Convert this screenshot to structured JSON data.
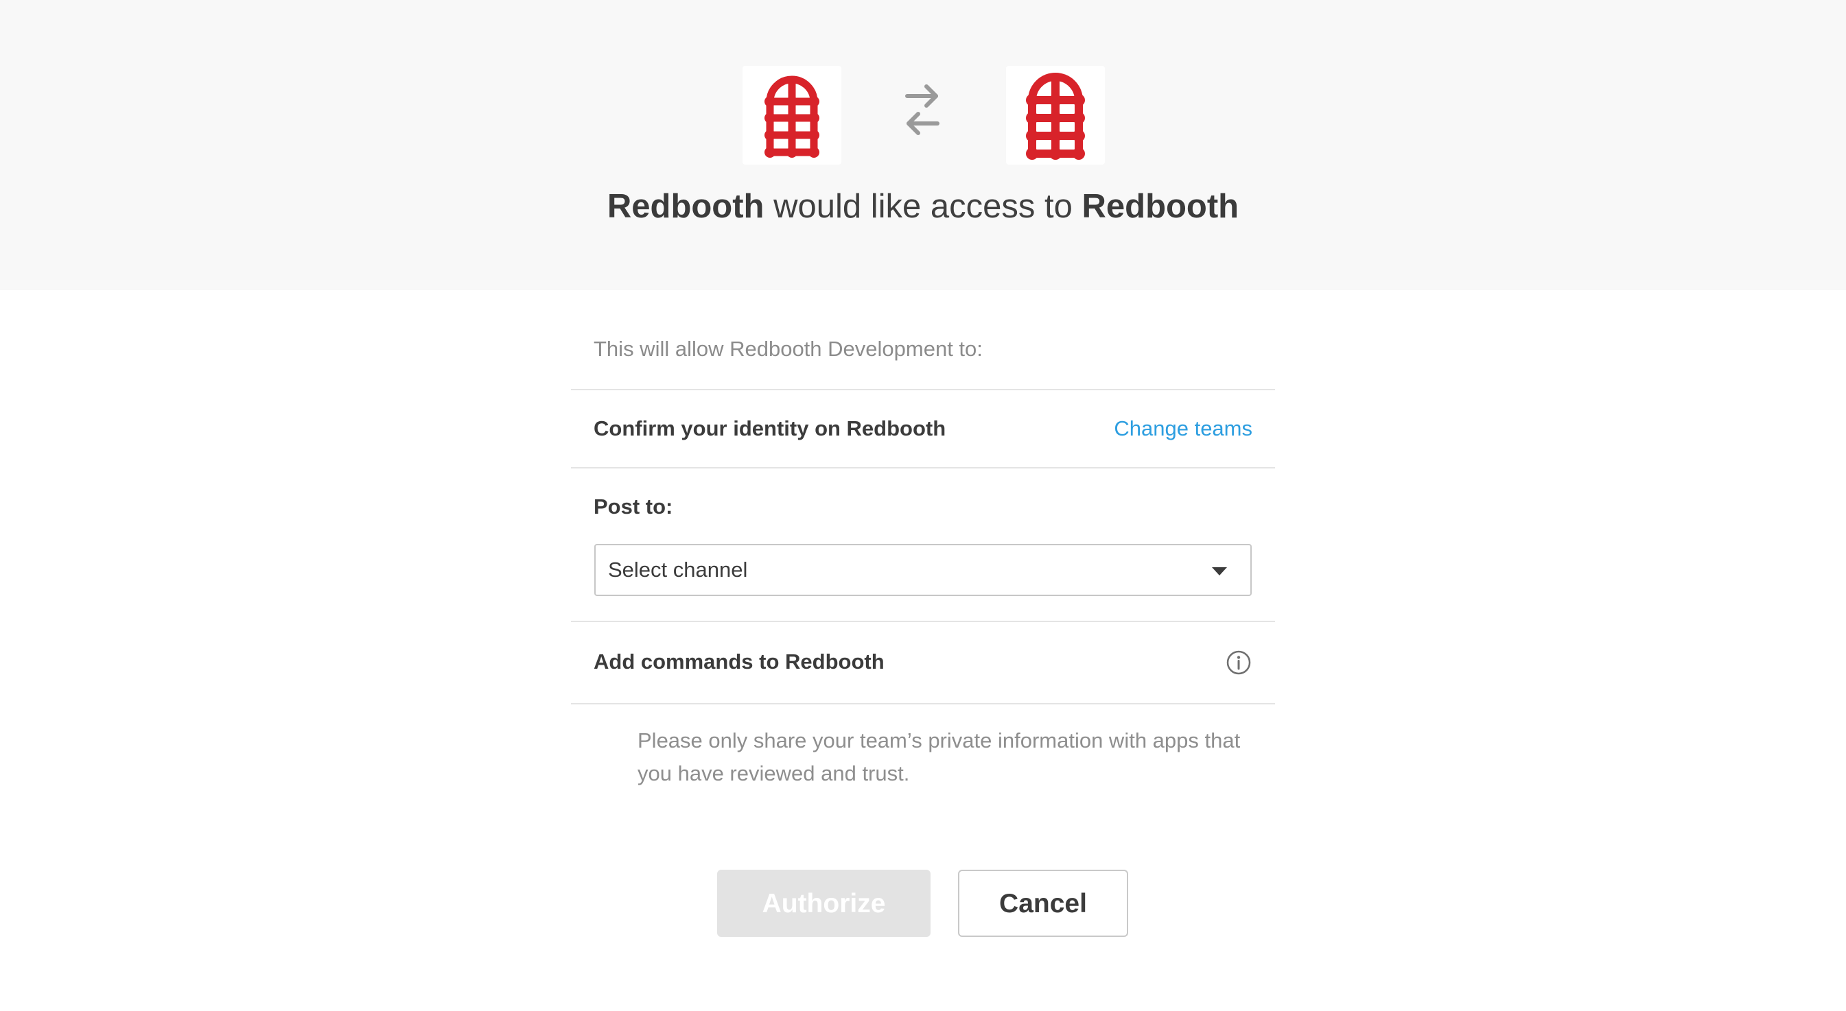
{
  "header": {
    "left_app_icon": "redbooth-logo",
    "right_app_icon": "redbooth-logo",
    "swap_icon": "swap-arrows-icon",
    "requesting_app": "Redbooth",
    "request_text": " would like access to ",
    "target_app": "Redbooth"
  },
  "permissions": {
    "intro": "This will allow Redbooth Development to:",
    "identity_label": "Confirm your identity on Redbooth",
    "change_teams_label": "Change teams",
    "post_to_label": "Post to:",
    "channel_select_value": "Select channel",
    "commands_label": "Add commands to Redbooth",
    "info_icon": "info-icon"
  },
  "notice": "Please only share your team’s private information with apps that you have reviewed and trust.",
  "actions": {
    "authorize_label": "Authorize",
    "cancel_label": "Cancel"
  },
  "colors": {
    "brand_red": "#d8232a",
    "link_blue": "#2d9ee0",
    "disabled_button": "#e3e3e3"
  }
}
